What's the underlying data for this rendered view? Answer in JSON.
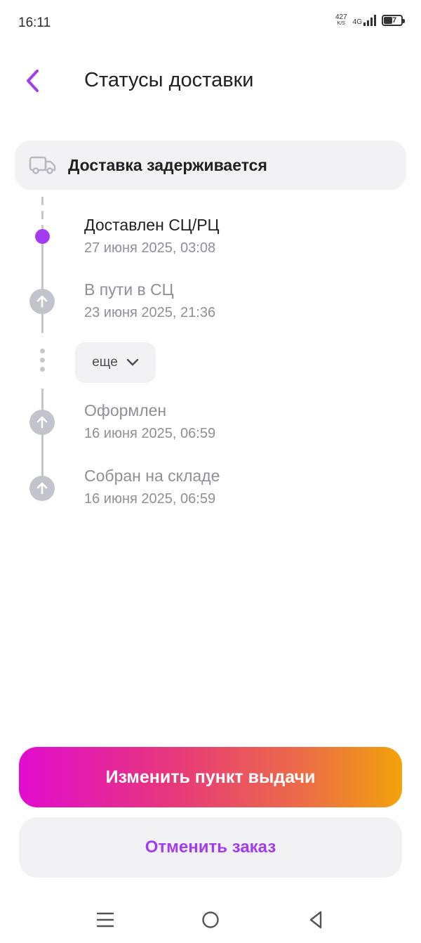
{
  "status_bar": {
    "time": "16:11",
    "net_speed_value": "427",
    "net_speed_unit": "K/S",
    "network_type": "4G",
    "battery_level": "47"
  },
  "header": {
    "title": "Статусы доставки",
    "back_icon": "chevron-left-icon"
  },
  "banner": {
    "icon": "truck-icon",
    "label": "Доставка задерживается"
  },
  "timeline": {
    "items": [
      {
        "title": "Доставлен СЦ/РЦ",
        "date": "27 июня 2025, 03:08",
        "state": "current"
      },
      {
        "title": "В пути в СЦ",
        "date": "23 июня 2025, 21:36",
        "state": "past"
      },
      {
        "title": "Оформлен",
        "date": "16 июня 2025, 06:59",
        "state": "past"
      },
      {
        "title": "Собран на складе",
        "date": "16 июня 2025, 06:59",
        "state": "past"
      }
    ],
    "more_label": "еще"
  },
  "actions": {
    "primary_label": "Изменить пункт выдачи",
    "secondary_label": "Отменить заказ"
  },
  "colors": {
    "accent": "#a33cf0",
    "gradient_start": "#e10bcf",
    "gradient_end": "#f2a20a",
    "muted": "#8f8f99"
  },
  "nav": {
    "menu_icon": "menu-icon",
    "home_icon": "home-circle-icon",
    "back_icon": "triangle-back-icon"
  }
}
